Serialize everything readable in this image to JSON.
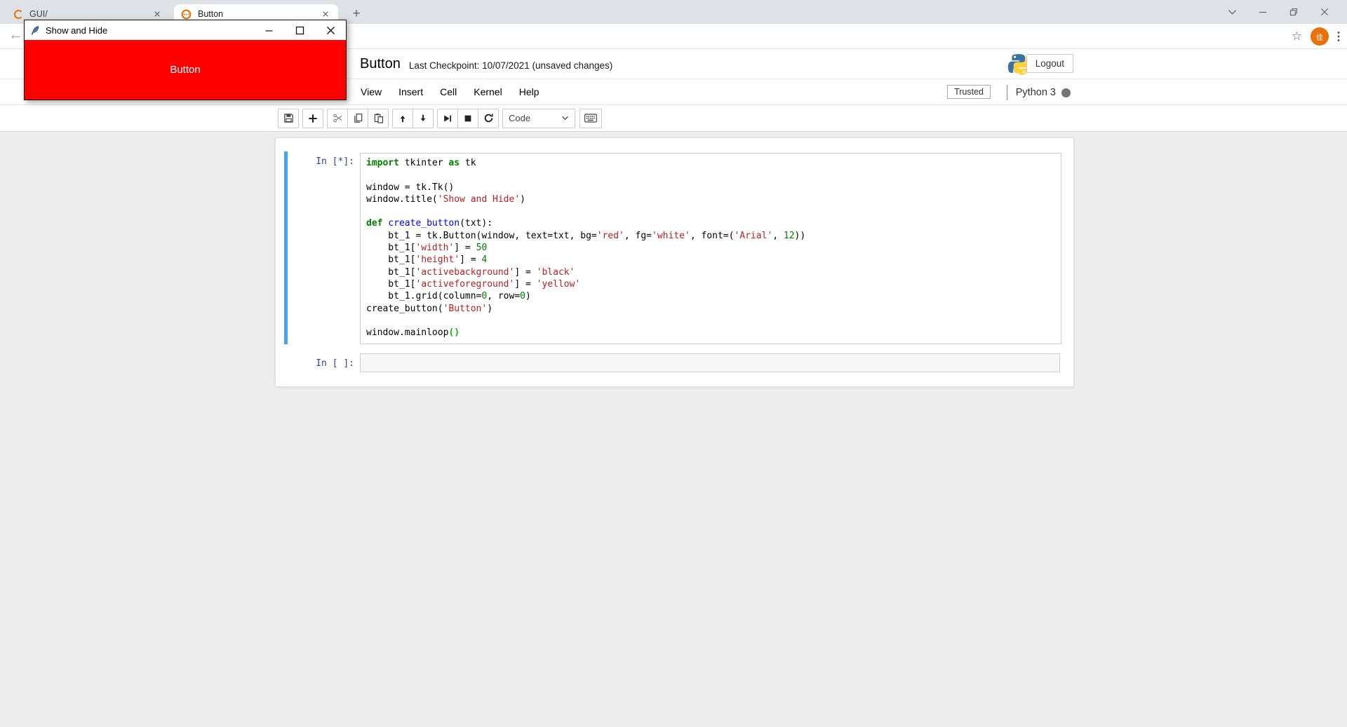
{
  "browser": {
    "tabs": [
      {
        "label": "GUI/",
        "icon": "loading-spinner-icon",
        "active": false
      },
      {
        "label": "Button",
        "icon": "jupyter-busy-icon",
        "active": true
      }
    ],
    "new_tab_glyph": "+",
    "window_controls": [
      "tab-search-chevron",
      "minimize",
      "restore",
      "close"
    ],
    "nav": {
      "back_glyph": "←",
      "star_glyph": "☆",
      "avatar_text": "佳"
    }
  },
  "tk_window": {
    "title": "Show and Hide",
    "controls": [
      "minimize",
      "maximize",
      "close"
    ],
    "button": {
      "label": "Button",
      "bg": "#fe0000",
      "fg": "#ffffff"
    }
  },
  "notebook": {
    "title": "Button",
    "checkpoint": "Last Checkpoint: 10/07/2021 (unsaved changes)",
    "logout_label": "Logout",
    "menus": [
      "View",
      "Insert",
      "Cell",
      "Kernel",
      "Help"
    ],
    "trusted_label": "Trusted",
    "kernel_name": "Python 3",
    "toolbar": {
      "buttons": [
        "save",
        "add-cell",
        "cut",
        "copy",
        "paste",
        "move-up",
        "move-down",
        "run",
        "stop",
        "restart"
      ],
      "cell_type_value": "Code",
      "keyboard_icon": "keyboard"
    },
    "cells": [
      {
        "prompt": "In [*]:",
        "selected": true,
        "lines": [
          [
            [
              "kw",
              "import"
            ],
            [
              "pl",
              " tkinter "
            ],
            [
              "kw",
              "as"
            ],
            [
              "pl",
              " tk"
            ]
          ],
          [],
          [
            [
              "pl",
              "window = tk.Tk()"
            ]
          ],
          [
            [
              "pl",
              "window.title("
            ],
            [
              "str",
              "'Show and Hide'"
            ],
            [
              "pl",
              ")"
            ]
          ],
          [],
          [
            [
              "kw",
              "def"
            ],
            [
              "pl",
              " "
            ],
            [
              "fn",
              "create_button"
            ],
            [
              "pl",
              "(txt):"
            ]
          ],
          [
            [
              "pl",
              "    bt_1 = tk.Button(window, text=txt, bg="
            ],
            [
              "str",
              "'red'"
            ],
            [
              "pl",
              ", fg="
            ],
            [
              "str",
              "'white'"
            ],
            [
              "pl",
              ", font=("
            ],
            [
              "str",
              "'Arial'"
            ],
            [
              "pl",
              ", "
            ],
            [
              "num",
              "12"
            ],
            [
              "pl",
              "))"
            ]
          ],
          [
            [
              "pl",
              "    bt_1["
            ],
            [
              "str",
              "'width'"
            ],
            [
              "pl",
              "] = "
            ],
            [
              "num",
              "50"
            ]
          ],
          [
            [
              "pl",
              "    bt_1["
            ],
            [
              "str",
              "'height'"
            ],
            [
              "pl",
              "] = "
            ],
            [
              "num",
              "4"
            ]
          ],
          [
            [
              "pl",
              "    bt_1["
            ],
            [
              "str",
              "'activebackground'"
            ],
            [
              "pl",
              "] = "
            ],
            [
              "str",
              "'black'"
            ]
          ],
          [
            [
              "pl",
              "    bt_1["
            ],
            [
              "str",
              "'activeforeground'"
            ],
            [
              "pl",
              "] = "
            ],
            [
              "str",
              "'yellow'"
            ]
          ],
          [
            [
              "pl",
              "    bt_1.grid(column="
            ],
            [
              "num",
              "0"
            ],
            [
              "pl",
              ", row="
            ],
            [
              "num",
              "0"
            ],
            [
              "pl",
              ")"
            ]
          ],
          [
            [
              "pl",
              "create_button("
            ],
            [
              "str",
              "'Button'"
            ],
            [
              "pl",
              ")"
            ]
          ],
          [],
          [
            [
              "pl",
              "window.mainloop"
            ],
            [
              "mb",
              "()"
            ]
          ]
        ]
      },
      {
        "prompt": "In [ ]:",
        "selected": false,
        "lines": []
      }
    ]
  },
  "colors": {
    "selected_cell_border": "#42a5f5",
    "jupyter_orange": "#e8710a",
    "kernel_busy_dot": "#757575",
    "tk_button_red": "#fe0000"
  }
}
